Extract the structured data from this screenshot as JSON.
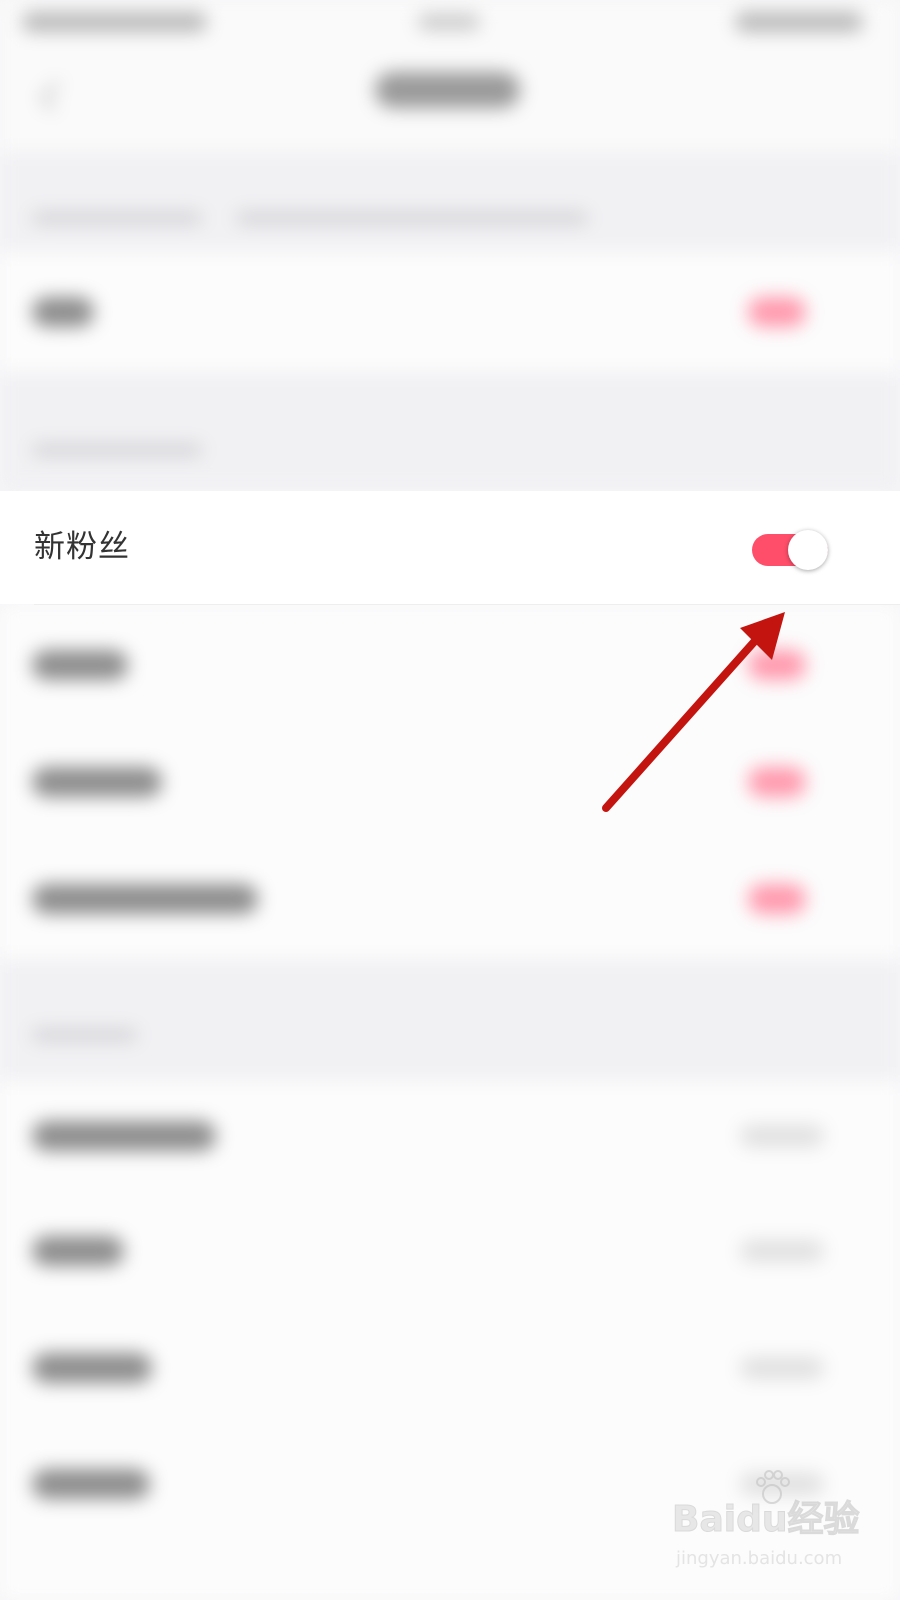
{
  "settings_row": {
    "label": "新粉丝",
    "toggle_on": true
  },
  "colors": {
    "toggle_accent": "#ff4e6a",
    "arrow": "#c3140f"
  },
  "watermark": {
    "logo": "Baidu经验",
    "url": "jingyan.baidu.com"
  },
  "icons": {
    "back": "back-chevron-icon",
    "arrow": "annotation-arrow",
    "watermark_paw": "paw-icon"
  }
}
